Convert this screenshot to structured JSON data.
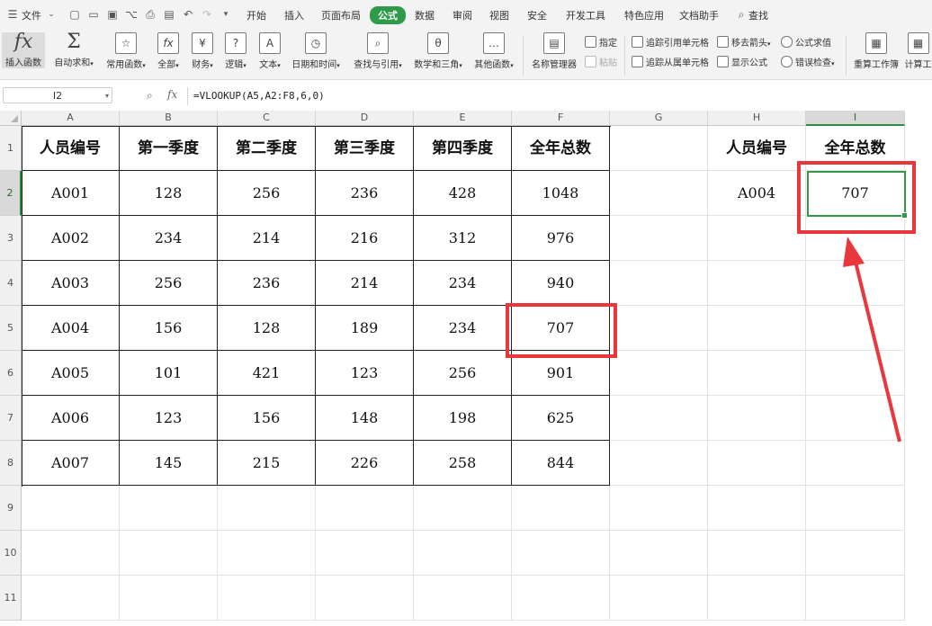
{
  "menu": {
    "file_label": "文件",
    "tabs": [
      "开始",
      "插入",
      "页面布局",
      "公式",
      "数据",
      "审阅",
      "视图",
      "安全",
      "开发工具",
      "特色应用",
      "文档助手"
    ],
    "active_tab": "公式",
    "search_label": "查找"
  },
  "ribbon": {
    "buttons": [
      {
        "label": "插入函数",
        "icon": "fx"
      },
      {
        "label": "自动求和",
        "icon": "Σ"
      },
      {
        "label": "常用函数",
        "icon": "☆"
      },
      {
        "label": "全部",
        "icon": "fx"
      },
      {
        "label": "财务",
        "icon": "¥"
      },
      {
        "label": "逻辑",
        "icon": "?"
      },
      {
        "label": "文本",
        "icon": "A"
      },
      {
        "label": "日期和时间",
        "icon": "◷"
      },
      {
        "label": "查找与引用",
        "icon": "⌕"
      },
      {
        "label": "数学和三角",
        "icon": "θ"
      },
      {
        "label": "其他函数",
        "icon": "…"
      }
    ],
    "name_manager": "名称管理器",
    "specify": "指定",
    "paste": "粘贴",
    "trace_precedents": "追踪引用单元格",
    "trace_dependents": "追踪从属单元格",
    "remove_arrows": "移去箭头",
    "show_formulas": "显示公式",
    "evaluate_formula": "公式求值",
    "error_check": "错误检查",
    "recalc": "重算工作簿",
    "calc": "计算工"
  },
  "formula_bar": {
    "name_box": "I2",
    "fx": "fx",
    "formula": "=VLOOKUP(A5,A2:F8,6,0)"
  },
  "columns": [
    "A",
    "B",
    "C",
    "D",
    "E",
    "F",
    "G",
    "H",
    "I"
  ],
  "rows": [
    "1",
    "2",
    "3",
    "4",
    "5",
    "6",
    "7",
    "8",
    "9",
    "10",
    "11"
  ],
  "table": {
    "headers": [
      "人员编号",
      "第一季度",
      "第二季度",
      "第三季度",
      "第四季度",
      "全年总数"
    ],
    "rows": [
      [
        "A001",
        "128",
        "256",
        "236",
        "428",
        "1048"
      ],
      [
        "A002",
        "234",
        "214",
        "216",
        "312",
        "976"
      ],
      [
        "A003",
        "256",
        "236",
        "214",
        "234",
        "940"
      ],
      [
        "A004",
        "156",
        "128",
        "189",
        "234",
        "707"
      ],
      [
        "A005",
        "101",
        "421",
        "123",
        "256",
        "901"
      ],
      [
        "A006",
        "123",
        "156",
        "148",
        "198",
        "625"
      ],
      [
        "A007",
        "145",
        "215",
        "226",
        "258",
        "844"
      ]
    ]
  },
  "lookup": {
    "header_id": "人员编号",
    "header_total": "全年总数",
    "id_value": "A004",
    "result_value": "707"
  },
  "colors": {
    "accent_green": "#2e9b4b",
    "highlight_red": "#e8383d"
  }
}
